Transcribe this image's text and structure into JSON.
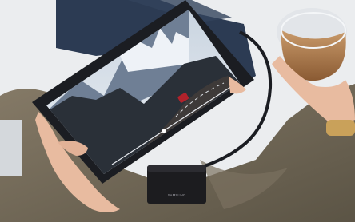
{
  "photo": {
    "brand_label": "SAMSUNG",
    "colors": {
      "background": "#ffffff",
      "sweater": "#6f6656",
      "tablet_frame": "#1b1d22",
      "sky": "#d7dde6",
      "mountains": "#6f7f95",
      "snow": "#eef2f7",
      "road": "#3e3a39",
      "car": "#b1222b",
      "ssd": "#1c1c1f",
      "drink": "#9b6a3f",
      "jeans": "#2c3b53",
      "skin": "#e8bba0"
    }
  }
}
